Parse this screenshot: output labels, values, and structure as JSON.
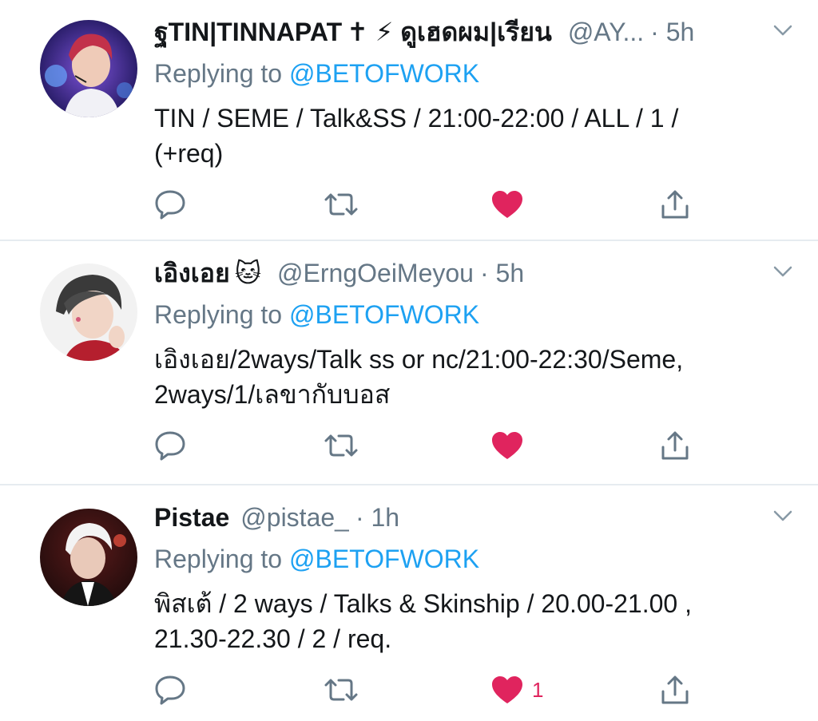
{
  "colors": {
    "accent": "#1da1f2",
    "like": "#e0245e",
    "muted": "#657786",
    "text": "#14171a",
    "divider": "#e6ecf0"
  },
  "tweets": [
    {
      "name": "ฐTIN|TINNAPAT",
      "name_suffix": "✝ ⚡ ดูเฮดผม|เรียน",
      "handle": "@AY...",
      "time": "· 5h",
      "reply_prefix": "Replying to",
      "reply_link": "@BETOFWORK",
      "body_line1": "TIN / SEME / Talk&SS / 21:00-22:00 / ALL / 1 /",
      "body_line2": "(+req)",
      "liked": true,
      "like_count": ""
    },
    {
      "name": "เอิงเอย",
      "name_suffix": "🐱",
      "handle": "@ErngOeiMeyou",
      "time": "· 5h",
      "reply_prefix": "Replying to",
      "reply_link": "@BETOFWORK",
      "body_line1": "เอิงเอย/2ways/Talk ss or nc/21:00-22:30/Seme,",
      "body_line2": "2ways/1/เลขากับบอส",
      "liked": true,
      "like_count": ""
    },
    {
      "name": "Pistae",
      "name_suffix": "",
      "handle": "@pistae_",
      "time": "· 1h",
      "reply_prefix": "Replying to",
      "reply_link": "@BETOFWORK",
      "body_line1": "พิสเต้ / 2 ways / Talks & Skinship / 20.00-21.00 ,",
      "body_line2": "21.30-22.30 / 2 / req.",
      "liked": true,
      "like_count": "1"
    }
  ],
  "icons": {
    "reply": "reply-icon",
    "retweet": "retweet-icon",
    "like": "heart-icon",
    "share": "share-icon",
    "caret": "chevron-down-icon"
  }
}
